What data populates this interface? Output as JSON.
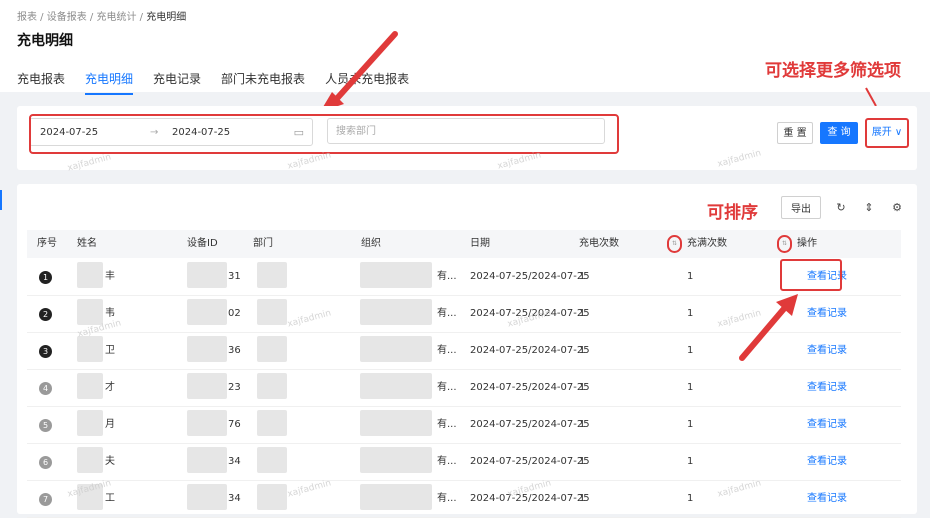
{
  "breadcrumb": [
    "报表",
    "设备报表",
    "充电统计",
    "充电明细"
  ],
  "page_title": "充电明细",
  "tabs": [
    {
      "label": "充电报表",
      "active": false
    },
    {
      "label": "充电明细",
      "active": true
    },
    {
      "label": "充电记录",
      "active": false
    },
    {
      "label": "部门未充电报表",
      "active": false
    },
    {
      "label": "人员未充电报表",
      "active": false
    }
  ],
  "filters": {
    "start_date": "2024-07-25",
    "end_date": "2024-07-25",
    "range_separator": "→",
    "dept_placeholder": "搜索部门",
    "reset_label": "重 置",
    "query_label": "查 询",
    "expand_label": "展开 ∨"
  },
  "annotations": {
    "more_filters": "可选择更多筛选项",
    "sortable": "可排序"
  },
  "toolbar": {
    "export_label": "导出",
    "refresh_icon": "refresh-icon",
    "density_icon": "column-height-icon",
    "settings_icon": "settings-icon"
  },
  "columns": [
    "序号",
    "姓名",
    "设备ID",
    "部门",
    "组织",
    "日期",
    "充电次数",
    "充满次数",
    "操作"
  ],
  "rows": [
    {
      "index": "1",
      "name": "丰",
      "device": "31",
      "org": "有...",
      "date": "2024-07-25/2024-07-25",
      "charge": "1",
      "full": "1",
      "action": "查看记录"
    },
    {
      "index": "2",
      "name": "韦",
      "device": "02",
      "org": "有...",
      "date": "2024-07-25/2024-07-25",
      "charge": "1",
      "full": "1",
      "action": "查看记录"
    },
    {
      "index": "3",
      "name": "卫",
      "device": "36",
      "org": "有...",
      "date": "2024-07-25/2024-07-25",
      "charge": "1",
      "full": "1",
      "action": "查看记录"
    },
    {
      "index": "4",
      "name": "才",
      "device": "23",
      "org": "有...",
      "date": "2024-07-25/2024-07-25",
      "charge": "1",
      "full": "1",
      "action": "查看记录"
    },
    {
      "index": "5",
      "name": "月",
      "device": "76",
      "org": "有...",
      "date": "2024-07-25/2024-07-25",
      "charge": "1",
      "full": "1",
      "action": "查看记录"
    },
    {
      "index": "6",
      "name": "夫",
      "device": "34",
      "org": "有...",
      "date": "2024-07-25/2024-07-25",
      "charge": "1",
      "full": "1",
      "action": "查看记录"
    },
    {
      "index": "7",
      "name": "工",
      "device": "34",
      "org": "有...",
      "date": "2024-07-25/2024-07-25",
      "charge": "1",
      "full": "1",
      "action": "查看记录"
    }
  ],
  "watermark": "xajfadmin",
  "colors": {
    "primary": "#1677ff",
    "annotation": "#e03a3a"
  }
}
